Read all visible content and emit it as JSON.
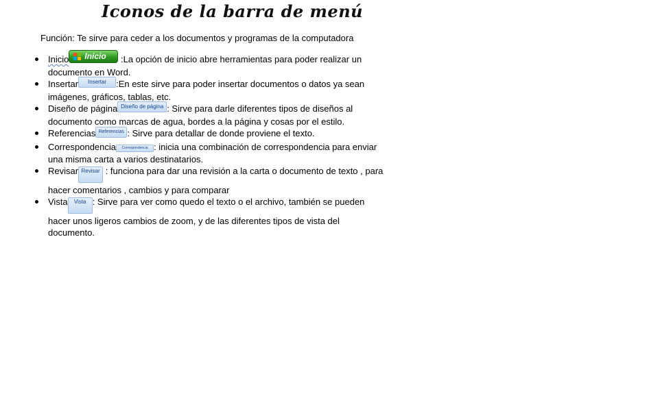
{
  "title": "Iconos de la barra  de menú",
  "funcion": "Función: Te sirve para ceder a los documentos y programas de la computadora",
  "items": [
    {
      "name": "Inicio",
      "button": "Inicio",
      "text": " :La opción de inicio abre herramientas  para poder realizar  un documento en Word."
    },
    {
      "name": "Insertar",
      "button": "Insertar",
      "text": ":En  este sirve para poder insertar documentos o datos ya sean imágenes, gráficos, tablas, etc."
    },
    {
      "name": "Diseño de página",
      "button": "Diseño de página",
      "text": ": Sirve para darle diferentes tipos de diseños al documento  como marcas de agua, bordes a la página y cosas por el estilo."
    },
    {
      "name": "Referencias",
      "button": "Referencias",
      "text": ": Sirve para detallar de donde proviene el texto."
    },
    {
      "name": "Correspondencia",
      "button": "Correspondencia",
      "text": ": inicia una combinación de correspondencia para enviar una misma carta a varios destinatarios."
    },
    {
      "name": "Revisar",
      "button": "Revisar",
      "text": " :  funciona para dar una revisión a la carta o documento de texto , para hacer  comentarios , cambios y para comparar"
    },
    {
      "name": "Vista",
      "button": "Vista",
      "text": ": Sirve para ver como quedo el texto o el archivo, también se pueden hacer unos ligeros cambios de zoom, y de las diferentes tipos de vista del documento."
    }
  ],
  "colors": {
    "start_button": "#2f9a22",
    "ribbon_tab": "#c6dbf3",
    "ribbon_text": "#15428b"
  }
}
